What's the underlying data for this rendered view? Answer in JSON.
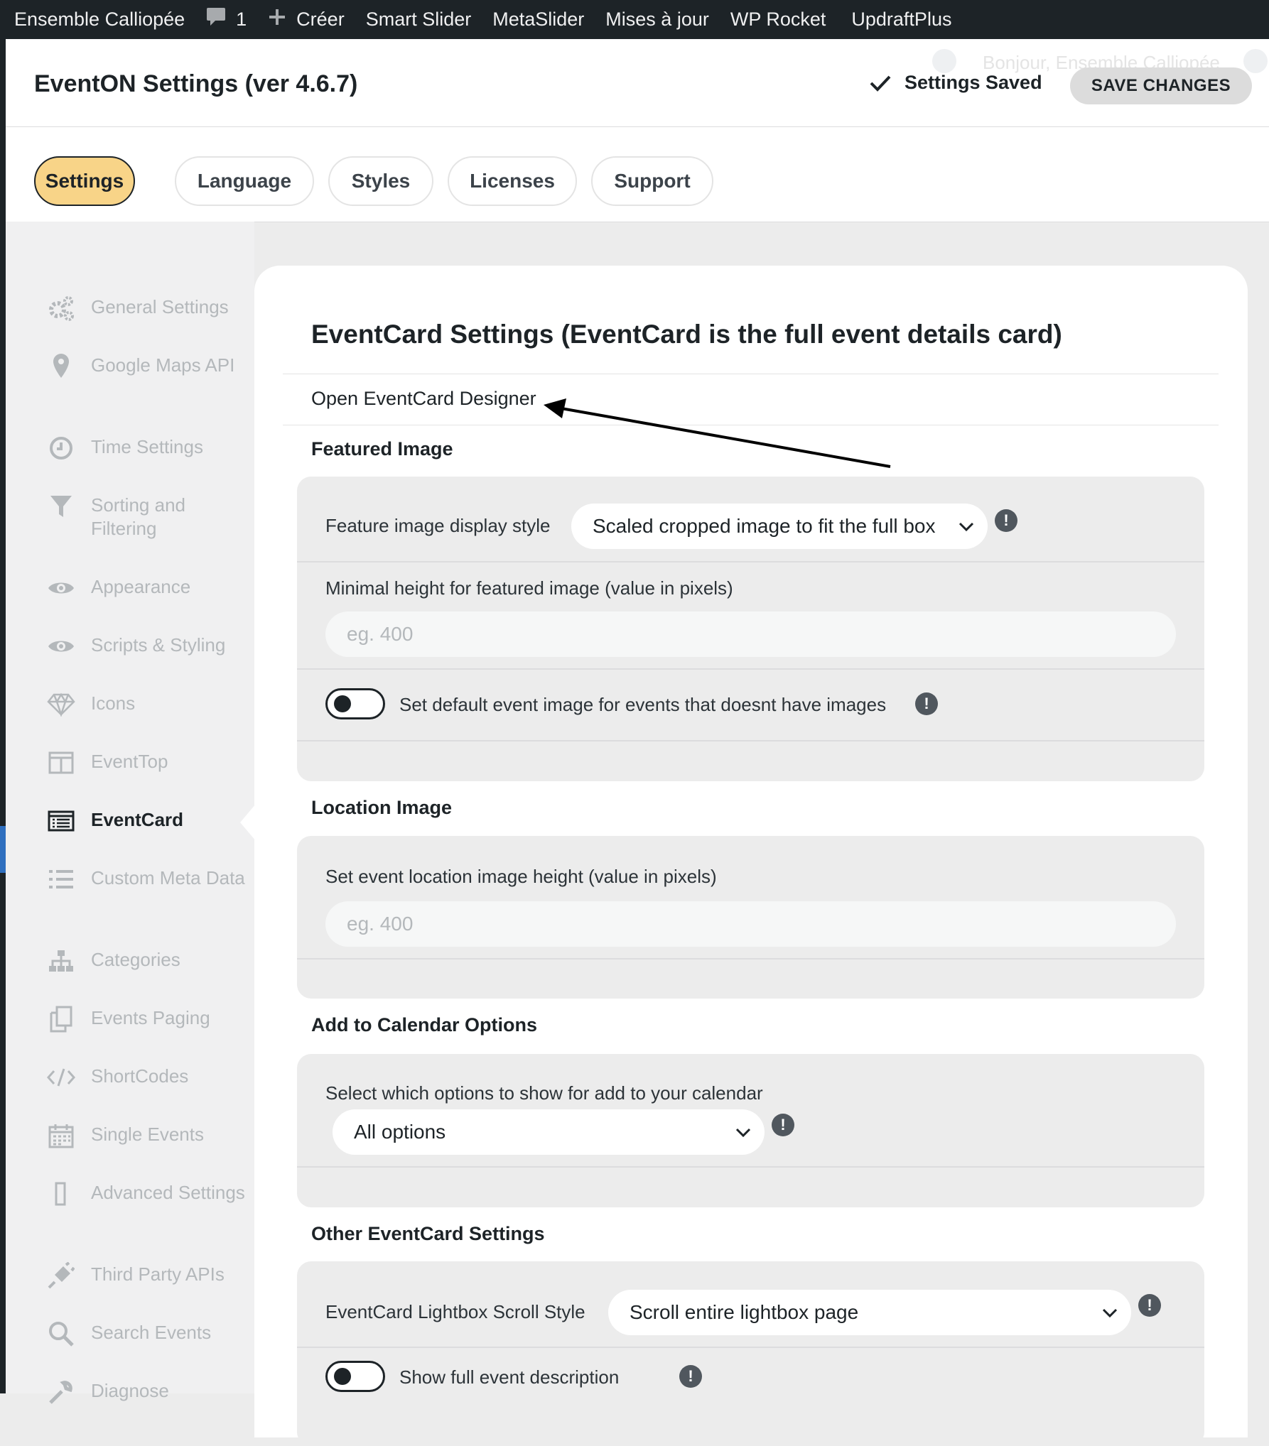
{
  "adminbar": {
    "site_name": "Ensemble Calliopée",
    "comments_count": "1",
    "new_label": "Créer",
    "items": [
      "Smart Slider",
      "MetaSlider",
      "Mises à jour",
      "WP Rocket",
      "UpdraftPlus"
    ]
  },
  "header": {
    "title": "EventON Settings (ver 4.6.7)",
    "greeting": "Bonjour, Ensemble Calliopée",
    "saved_text": "Settings Saved",
    "save_button": "SAVE CHANGES"
  },
  "tabs": [
    "Settings",
    "Language",
    "Styles",
    "Licenses",
    "Support"
  ],
  "active_tab": "Settings",
  "sidebar": {
    "items": [
      {
        "label": "General Settings",
        "icon": "gears-icon"
      },
      {
        "label": "Google Maps API",
        "icon": "map-pin-icon"
      },
      {
        "label": "Time Settings",
        "icon": "clock-icon"
      },
      {
        "label": "Sorting and Filtering",
        "icon": "filter-icon"
      },
      {
        "label": "Appearance",
        "icon": "eye-icon"
      },
      {
        "label": "Scripts & Styling",
        "icon": "eye-icon"
      },
      {
        "label": "Icons",
        "icon": "diamond-icon"
      },
      {
        "label": "EventTop",
        "icon": "columns-icon"
      },
      {
        "label": "EventCard",
        "icon": "card-list-icon"
      },
      {
        "label": "Custom Meta Data",
        "icon": "list-icon"
      },
      {
        "label": "Categories",
        "icon": "sitemap-icon"
      },
      {
        "label": "Events Paging",
        "icon": "copy-icon"
      },
      {
        "label": "ShortCodes",
        "icon": "code-icon"
      },
      {
        "label": "Single Events",
        "icon": "calendar-icon"
      },
      {
        "label": "Advanced Settings",
        "icon": "rectangle-icon"
      },
      {
        "label": "Third Party APIs",
        "icon": "plug-icon"
      },
      {
        "label": "Search Events",
        "icon": "search-icon"
      },
      {
        "label": "Diagnose",
        "icon": "wrench-icon"
      }
    ],
    "active": "EventCard"
  },
  "content": {
    "title": "EventCard Settings (EventCard is the full event details card)",
    "designer_link": "Open EventCard Designer",
    "featured": {
      "heading": "Featured Image",
      "display_style_label": "Feature image display style",
      "display_style_value": "Scaled cropped image to fit the full box",
      "min_height_label": "Minimal height for featured image (value in pixels)",
      "min_height_placeholder": "eg. 400",
      "default_image_label": "Set default event image for events that doesnt have images",
      "default_image_on": false
    },
    "location": {
      "heading": "Location Image",
      "height_label": "Set event location image height (value in pixels)",
      "height_placeholder": "eg. 400"
    },
    "add_to_calendar": {
      "heading": "Add to Calendar Options",
      "select_label": "Select which options to show for add to your calendar",
      "select_value": "All options"
    },
    "other": {
      "heading": "Other EventCard Settings",
      "scroll_style_label": "EventCard Lightbox Scroll Style",
      "scroll_style_value": "Scroll entire lightbox page",
      "full_desc_label": "Show full event description",
      "full_desc_on": false
    }
  },
  "colors": {
    "adminbar": "#1d2327",
    "active_tab": "#f8d488",
    "page_bg": "#ececec",
    "group_bg": "#ececec"
  }
}
